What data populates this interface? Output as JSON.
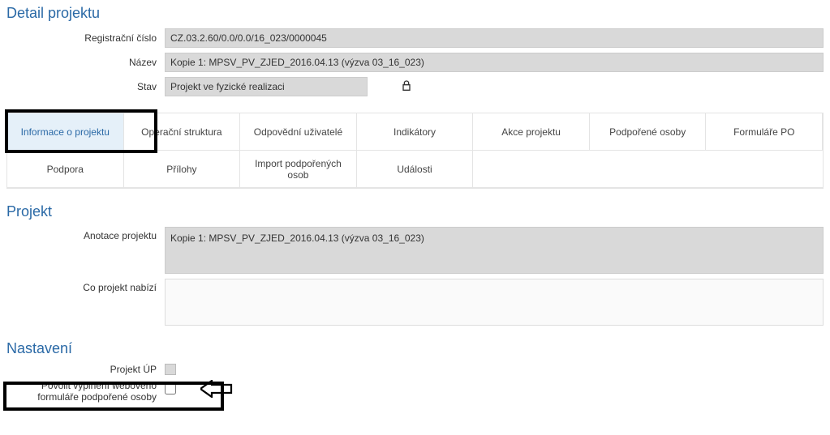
{
  "sections": {
    "detail_title": "Detail projektu",
    "project_title": "Projekt",
    "settings_title": "Nastavení"
  },
  "detail": {
    "reg_label": "Registrační číslo",
    "reg_value": "CZ.03.2.60/0.0/0.0/16_023/0000045",
    "name_label": "Název",
    "name_value": "Kopie 1: MPSV_PV_ZJED_2016.04.13 (výzva 03_16_023)",
    "state_label": "Stav",
    "state_value": "Projekt ve fyzické realizaci"
  },
  "tabs": [
    {
      "label": "Informace o projektu",
      "active": true
    },
    {
      "label": "Operační struktura"
    },
    {
      "label": "Odpovědní uživatelé"
    },
    {
      "label": "Indikátory"
    },
    {
      "label": "Akce projektu"
    },
    {
      "label": "Podpořené osoby"
    },
    {
      "label": "Formuláře PO"
    },
    {
      "label": "Podpora"
    },
    {
      "label": "Přílohy"
    },
    {
      "label": "Import podpořených osob"
    },
    {
      "label": "Události"
    }
  ],
  "project": {
    "annotation_label": "Anotace projektu",
    "annotation_value": "Kopie 1: MPSV_PV_ZJED_2016.04.13 (výzva 03_16_023)",
    "offers_label": "Co projekt nabízí",
    "offers_value": ""
  },
  "settings": {
    "up_label": "Projekt ÚP",
    "webform_label": "Povolit vyplnění webového formuláře podpořené osoby"
  }
}
